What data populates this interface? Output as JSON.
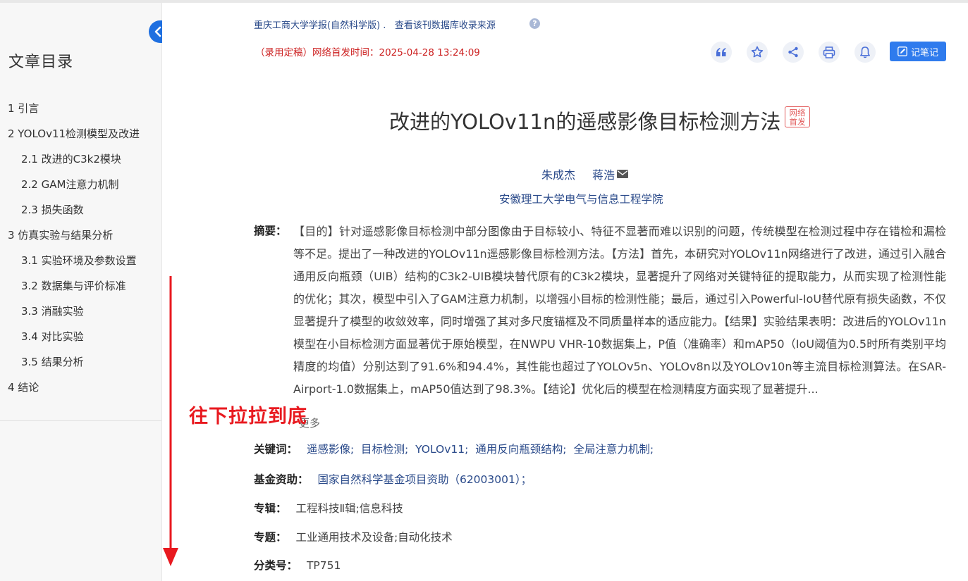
{
  "sidebar": {
    "title": "文章目录",
    "items": [
      {
        "label": "1 引言",
        "level": 1
      },
      {
        "label": "2 YOLOv11检测模型及改进",
        "level": 1
      },
      {
        "label": "2.1 改进的C3k2模块",
        "level": 2
      },
      {
        "label": "2.2 GAM注意力机制",
        "level": 2
      },
      {
        "label": "2.3 损失函数",
        "level": 2
      },
      {
        "label": "3 仿真实验与结果分析",
        "level": 1
      },
      {
        "label": "3.1 实验环境及参数设置",
        "level": 2
      },
      {
        "label": "3.2 数据集与评价标准",
        "level": 2
      },
      {
        "label": "3.3 消融实验",
        "level": 2
      },
      {
        "label": "3.4 对比实验",
        "level": 2
      },
      {
        "label": "3.5 结果分析",
        "level": 2
      },
      {
        "label": "4 结论",
        "level": 1
      }
    ]
  },
  "header": {
    "journal": "重庆工商大学学报(自然科学版)",
    "journal_sep": " . ",
    "source_link": "查看该刊数据库收录来源",
    "help_icon": "?",
    "pubdate": "（录用定稿）网络首发时间：2025-04-28 13:24:09"
  },
  "toolbar": {
    "icons": [
      "quote-icon",
      "star-icon",
      "share-icon",
      "print-icon",
      "bell-icon"
    ],
    "note_label": "记笔记"
  },
  "article": {
    "title": "改进的YOLOv11n的遥感影像目标检测方法",
    "badge_line1": "网络",
    "badge_line2": "首发",
    "author1": "朱成杰",
    "author2": "蒋浩",
    "affiliation": "安徽理工大学电气与信息工程学院",
    "abstract_label": "摘要：",
    "abstract": "【目的】针对遥感影像目标检测中部分图像由于目标较小、特征不显著而难以识别的问题，传统模型在检测过程中存在错检和漏检等不足。提出了一种改进的YOLOv11n遥感影像目标检测方法。【方法】首先，本研究对YOLOv11n网络进行了改进，通过引入融合通用反向瓶颈（UIB）结构的C3k2-UIB模块替代原有的C3k2模块，显著提升了网络对关键特征的提取能力，从而实现了检测性能的优化；其次，模型中引入了GAM注意力机制，以增强小目标的检测性能；最后，通过引入Powerful-IoU替代原有损失函数，不仅显著提升了模型的收敛效率，同时增强了其对多尺度锚框及不同质量样本的适应能力。【结果】实验结果表明：改进后的YOLOv11n模型在小目标检测方面显著优于原始模型，在NWPU VHR-10数据集上，P值（准确率）和mAP50（IoU阈值为0.5时所有类别平均精度的均值）分别达到了91.6%和94.4%，其性能也超过了YOLOv5n、YOLOv8n以及YOLOv10n等主流目标检测算法。在SAR-Airport-1.0数据集上，mAP50值达到了98.3%。【结论】优化后的模型在检测精度方面实现了显著提升...",
    "more": "更多",
    "keywords_label": "关键词：",
    "keywords": [
      "遥感影像;",
      "目标检测;",
      "YOLOv11;",
      "通用反向瓶颈结构;",
      "全局注意力机制;"
    ],
    "fund_label": "基金资助：",
    "fund": "国家自然科学基金项目资助（62003001）；",
    "album_label": "专辑：",
    "album": "工程科技Ⅱ辑;信息科技",
    "topic_label": "专题：",
    "topic": "工业通用技术及设备;自动化技术",
    "class_label": "分类号：",
    "class": "TP751"
  },
  "annotation": {
    "text": "往下拉拉到底",
    "color": "#e8191f"
  }
}
